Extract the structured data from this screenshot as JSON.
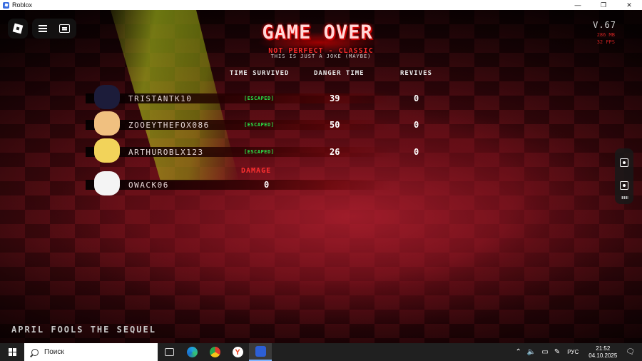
{
  "window": {
    "app_title": "Roblox",
    "minimize": "—",
    "maximize": "❐",
    "close": "✕"
  },
  "hud": {
    "title": "GAME OVER",
    "subtitle": "NOT PERFECT - CLASSIC",
    "joke": "THIS IS JUST A JOKE (MAYBE)",
    "version": "V.67",
    "memory": "286 MB",
    "fps": "32 FPS",
    "footer": "APRIL FOOLS THE SEQUEL"
  },
  "columns": {
    "time_survived": "TIME SURVIVED",
    "danger_time": "DANGER TIME",
    "revives": "REVIVES"
  },
  "players": [
    {
      "name": "TRISTANTK10",
      "status": "[ESCAPED]",
      "danger_time": "39",
      "revives": "0",
      "avatar_color": "#1c1c3a"
    },
    {
      "name": "ZOOEYTHEFOX086",
      "status": "[ESCAPED]",
      "danger_time": "50",
      "revives": "0",
      "avatar_color": "#f0c080"
    },
    {
      "name": "ARTHUROBLX123",
      "status": "[ESCAPED]",
      "danger_time": "26",
      "revives": "0",
      "avatar_color": "#f2d35a"
    }
  ],
  "killer": {
    "label": "DAMAGE",
    "name": "OWACK06",
    "damage": "0",
    "avatar_color": "#f4f4f4"
  },
  "taskbar": {
    "search_placeholder": "Поиск",
    "language": "РУС",
    "time": "21:52",
    "date": "04.10.2025"
  },
  "colors": {
    "accent_red": "#ff2a2a",
    "escaped_green": "#29e84a",
    "beam_yellow": "#c8e01e"
  }
}
